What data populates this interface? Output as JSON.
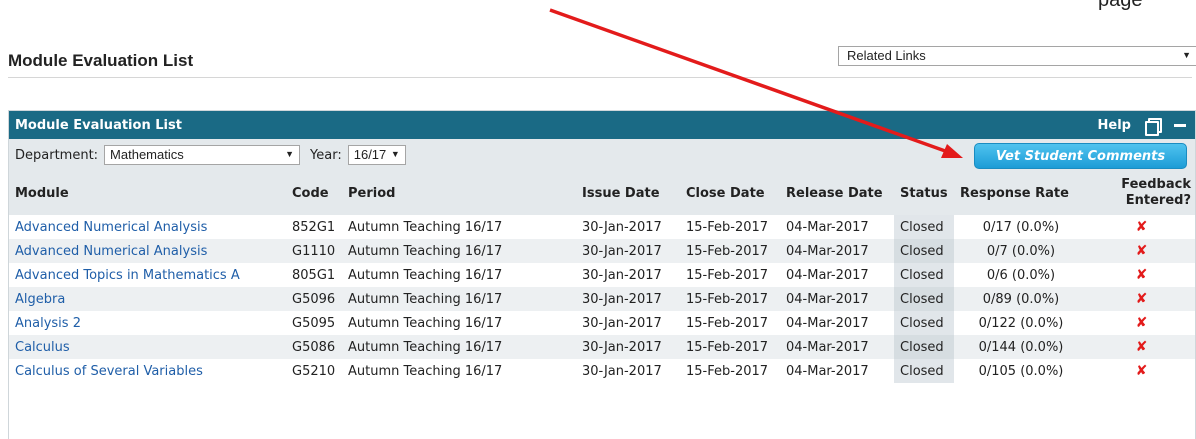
{
  "cutoff_text": "page",
  "page_title": "Module Evaluation List",
  "related_links": {
    "selected": "Related Links"
  },
  "panel": {
    "title": "Module Evaluation List",
    "help_label": "Help"
  },
  "filters": {
    "department_label": "Department:",
    "department_value": "Mathematics",
    "year_label": "Year:",
    "year_value": "16/17",
    "vet_button_label": "Vet Student Comments"
  },
  "table": {
    "headers": {
      "module": "Module",
      "code": "Code",
      "period": "Period",
      "issue_date": "Issue Date",
      "close_date": "Close Date",
      "release_date": "Release Date",
      "status": "Status",
      "response_rate": "Response Rate",
      "feedback_line1": "Feedback",
      "feedback_line2": "Entered?"
    },
    "rows": [
      {
        "module": "Advanced Numerical Analysis",
        "code": "852G1",
        "period": "Autumn Teaching 16/17",
        "issue": "30-Jan-2017",
        "close": "15-Feb-2017",
        "release": "04-Mar-2017",
        "status": "Closed",
        "rate": "0/17 (0.0%)",
        "feedback": "✘"
      },
      {
        "module": "Advanced Numerical Analysis",
        "code": "G1110",
        "period": "Autumn Teaching 16/17",
        "issue": "30-Jan-2017",
        "close": "15-Feb-2017",
        "release": "04-Mar-2017",
        "status": "Closed",
        "rate": "0/7 (0.0%)",
        "feedback": "✘"
      },
      {
        "module": "Advanced Topics in Mathematics A",
        "code": "805G1",
        "period": "Autumn Teaching 16/17",
        "issue": "30-Jan-2017",
        "close": "15-Feb-2017",
        "release": "04-Mar-2017",
        "status": "Closed",
        "rate": "0/6 (0.0%)",
        "feedback": "✘"
      },
      {
        "module": "Algebra",
        "code": "G5096",
        "period": "Autumn Teaching 16/17",
        "issue": "30-Jan-2017",
        "close": "15-Feb-2017",
        "release": "04-Mar-2017",
        "status": "Closed",
        "rate": "0/89 (0.0%)",
        "feedback": "✘"
      },
      {
        "module": "Analysis 2",
        "code": "G5095",
        "period": "Autumn Teaching 16/17",
        "issue": "30-Jan-2017",
        "close": "15-Feb-2017",
        "release": "04-Mar-2017",
        "status": "Closed",
        "rate": "0/122 (0.0%)",
        "feedback": "✘"
      },
      {
        "module": "Calculus",
        "code": "G5086",
        "period": "Autumn Teaching 16/17",
        "issue": "30-Jan-2017",
        "close": "15-Feb-2017",
        "release": "04-Mar-2017",
        "status": "Closed",
        "rate": "0/144 (0.0%)",
        "feedback": "✘"
      },
      {
        "module": "Calculus of Several Variables",
        "code": "G5210",
        "period": "Autumn Teaching 16/17",
        "issue": "30-Jan-2017",
        "close": "15-Feb-2017",
        "release": "04-Mar-2017",
        "status": "Closed",
        "rate": "0/105 (0.0%)",
        "feedback": "✘"
      }
    ]
  },
  "colors": {
    "header_bar": "#1a6a85",
    "link": "#1f5ea8",
    "button": "#1c9cd6",
    "annotation_arrow": "#e31b1b",
    "cross": "#e31b1b"
  },
  "icons": {
    "restore": "restore-window-icon",
    "minimize": "minimize-icon",
    "dropdown": "dropdown-arrow-icon",
    "not_entered": "red-cross-icon"
  }
}
